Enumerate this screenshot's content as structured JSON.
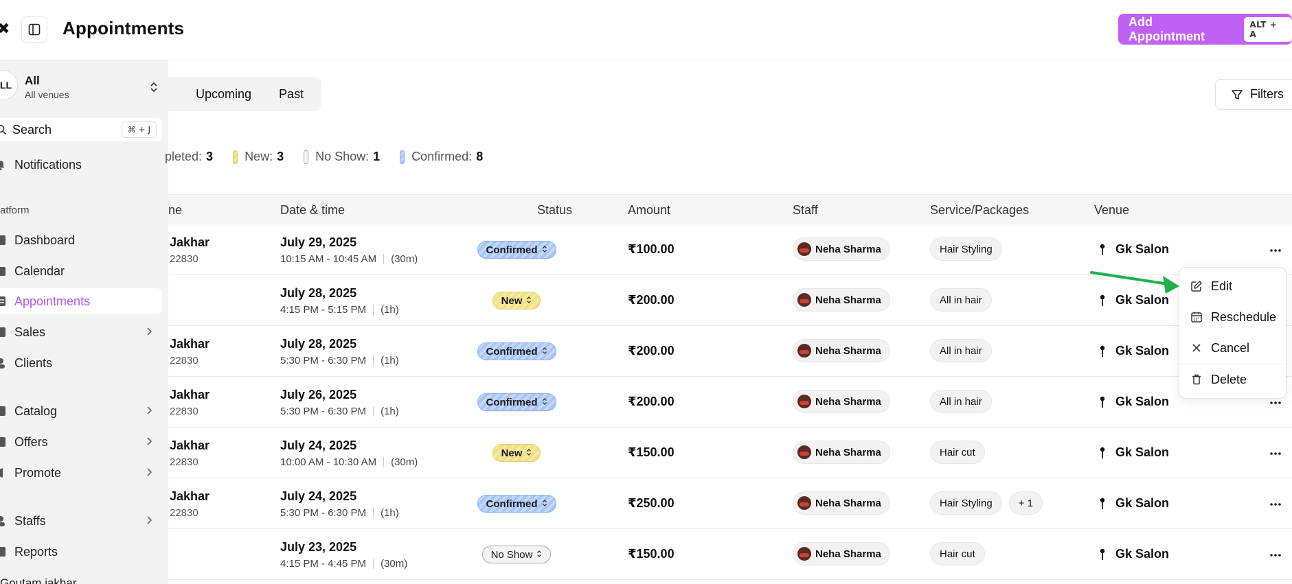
{
  "header": {
    "title": "Appointments",
    "add_button_label": "Add Appointment",
    "add_button_shortcut": "ALT + A"
  },
  "sidebar": {
    "venue_avatar": "LL",
    "venue_name": "All",
    "venue_sub": "All venues",
    "search_label": "Search",
    "search_shortcut": "⌘ + J",
    "notifications_label": "Notifications",
    "section_label": "atform",
    "items": [
      {
        "label": "Dashboard"
      },
      {
        "label": "Calendar"
      },
      {
        "label": "Appointments"
      },
      {
        "label": "Sales"
      },
      {
        "label": "Clients"
      },
      {
        "label": "Catalog"
      },
      {
        "label": "Offers"
      },
      {
        "label": "Promote"
      },
      {
        "label": "Staffs"
      },
      {
        "label": "Reports"
      }
    ],
    "user_label": "Goutam jakhar"
  },
  "tabs": {
    "upcoming": "Upcoming",
    "past": "Past"
  },
  "filters_label": "Filters",
  "legend": [
    {
      "label": "pleted:",
      "count": "3",
      "color": "#f2f2f2"
    },
    {
      "label": "New:",
      "count": "3",
      "color": "#f1dc7c"
    },
    {
      "label": "No Show:",
      "count": "1",
      "color": "#e9e9e9"
    },
    {
      "label": "Confirmed:",
      "count": "8",
      "color": "#a9c6f6"
    }
  ],
  "table": {
    "headers": {
      "name": "ne",
      "datetime": "Date & time",
      "status": "Status",
      "amount": "Amount",
      "staff": "Staff",
      "service": "Service/Packages",
      "venue": "Venue"
    },
    "rows": [
      {
        "name": "Jakhar",
        "phone": "22830",
        "date": "July 29, 2025",
        "time": "10:15 AM - 10:45 AM",
        "duration": "(30m)",
        "status": "Confirmed",
        "amount": "₹100.00",
        "staff": "Neha Sharma",
        "services": [
          "Hair Styling"
        ],
        "venue": "Gk Salon"
      },
      {
        "name": "",
        "phone": "",
        "date": "July 28, 2025",
        "time": "4:15 PM - 5:15 PM",
        "duration": "(1h)",
        "status": "New",
        "amount": "₹200.00",
        "staff": "Neha Sharma",
        "services": [
          "All in hair"
        ],
        "venue": "Gk Salon"
      },
      {
        "name": "Jakhar",
        "phone": "22830",
        "date": "July 28, 2025",
        "time": "5:30 PM - 6:30 PM",
        "duration": "(1h)",
        "status": "Confirmed",
        "amount": "₹200.00",
        "staff": "Neha Sharma",
        "services": [
          "All in hair"
        ],
        "venue": "Gk Salon"
      },
      {
        "name": "Jakhar",
        "phone": "22830",
        "date": "July 26, 2025",
        "time": "5:30 PM - 6:30 PM",
        "duration": "(1h)",
        "status": "Confirmed",
        "amount": "₹200.00",
        "staff": "Neha Sharma",
        "services": [
          "All in hair"
        ],
        "venue": "Gk Salon"
      },
      {
        "name": "Jakhar",
        "phone": "22830",
        "date": "July 24, 2025",
        "time": "10:00 AM - 10:30 AM",
        "duration": "(30m)",
        "status": "New",
        "amount": "₹150.00",
        "staff": "Neha Sharma",
        "services": [
          "Hair cut"
        ],
        "venue": "Gk Salon"
      },
      {
        "name": "Jakhar",
        "phone": "22830",
        "date": "July 24, 2025",
        "time": "5:30 PM - 6:30 PM",
        "duration": "(1h)",
        "status": "Confirmed",
        "amount": "₹250.00",
        "staff": "Neha Sharma",
        "services": [
          "Hair Styling",
          "+ 1"
        ],
        "venue": "Gk Salon"
      },
      {
        "name": "",
        "phone": "",
        "date": "July 23, 2025",
        "time": "4:15 PM - 4:45 PM",
        "duration": "(30m)",
        "status": "No Show",
        "amount": "₹150.00",
        "staff": "Neha Sharma",
        "services": [
          "Hair cut"
        ],
        "venue": "Gk Salon"
      }
    ]
  },
  "context_menu": {
    "edit": "Edit",
    "reschedule": "Reschedule",
    "cancel": "Cancel",
    "delete": "Delete"
  },
  "colors": {
    "accent": "#c160f5",
    "sidebar_active": "#b455ef",
    "annotation_arrow": "#1fb14a"
  }
}
